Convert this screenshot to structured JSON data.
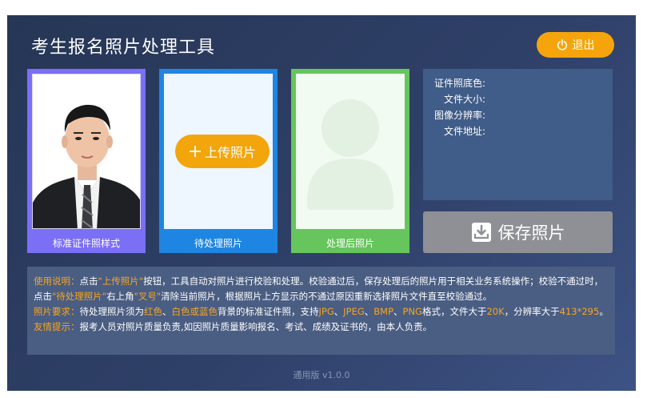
{
  "app": {
    "title": "考生报名照片处理工具",
    "logout_label": "退出",
    "version": "通用版 v1.0.0"
  },
  "cards": {
    "sample_label": "标准证件照样式",
    "pending_label": "待处理照片",
    "processed_label": "处理后照片",
    "upload_button": "上传照片"
  },
  "info": {
    "bg_color_label": "证件照底色:",
    "file_size_label": "文件大小:",
    "resolution_label": "图像分辨率:",
    "file_path_label": "文件地址:",
    "bg_color_value": "",
    "file_size_value": "",
    "resolution_value": "",
    "file_path_value": ""
  },
  "save_button": "保存照片",
  "notes": {
    "usage_title": "使用说明：",
    "usage_1": "点击",
    "usage_upload": "\"上传照片\"",
    "usage_2": "按钮，工具自动对照片进行校验和处理。校验通过后，保存处理后的照片用于相关业务系统操作；校验不通过时，点击",
    "usage_pending": "\"待处理照片\"",
    "usage_3": "右上角",
    "usage_x": "\"叉号\"",
    "usage_4": "清除当前照片，根据照片上方显示的不通过原因重新选择照片文件直至校验通过。",
    "req_title": "照片要求：",
    "req_1": "待处理照片须为",
    "req_red": "红色",
    "req_sep1": "、",
    "req_white": "白色或蓝色",
    "req_2": "背景的标准证件照，支持",
    "req_jpg": "JPG",
    "req_sep2": "、",
    "req_jpeg": "JPEG",
    "req_sep3": "、",
    "req_bmp": "BMP",
    "req_sep4": "、",
    "req_png": "PNG",
    "req_3": "格式，文件大于",
    "req_size": "20K",
    "req_4": "，分辨率大于",
    "req_res": "413*295",
    "req_5": "。",
    "tip_title": "友情提示：",
    "tip_text": "报考人员对照片质量负责,如因照片质量影响报名、考试、成绩及证书的，由本人负责。"
  },
  "colors": {
    "accent": "#f5a50b",
    "sample_border": "#7b6ff5",
    "pending_border": "#1e86e2",
    "processed_border": "#66c55c",
    "save_button": "#8e9095"
  },
  "icons": {
    "logout": "power-icon",
    "upload": "plus-icon",
    "save": "download-tray-icon",
    "placeholder": "person-silhouette-icon"
  }
}
